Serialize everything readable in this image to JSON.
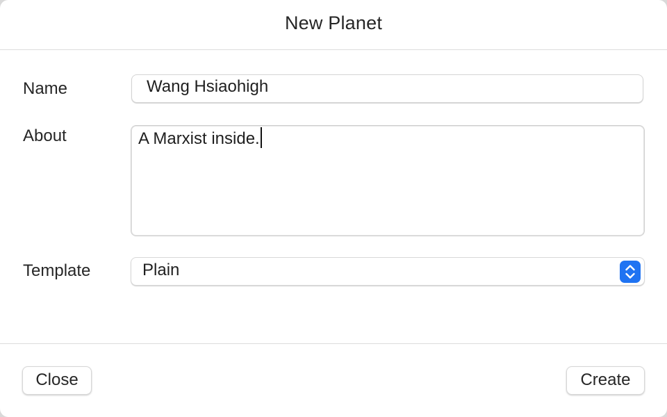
{
  "window": {
    "title": "New Planet"
  },
  "form": {
    "name_label": "Name",
    "name_value": "Wang Hsiaohigh",
    "about_label": "About",
    "about_value": "A Marxist inside.",
    "template_label": "Template",
    "template_value": "Plain",
    "template_control_icon": "up-down-chevrons-icon"
  },
  "footer": {
    "close_label": "Close",
    "create_label": "Create"
  },
  "colors": {
    "accent": "#1f73f2",
    "background": "#ffffff",
    "separator": "#dcdcdc"
  }
}
